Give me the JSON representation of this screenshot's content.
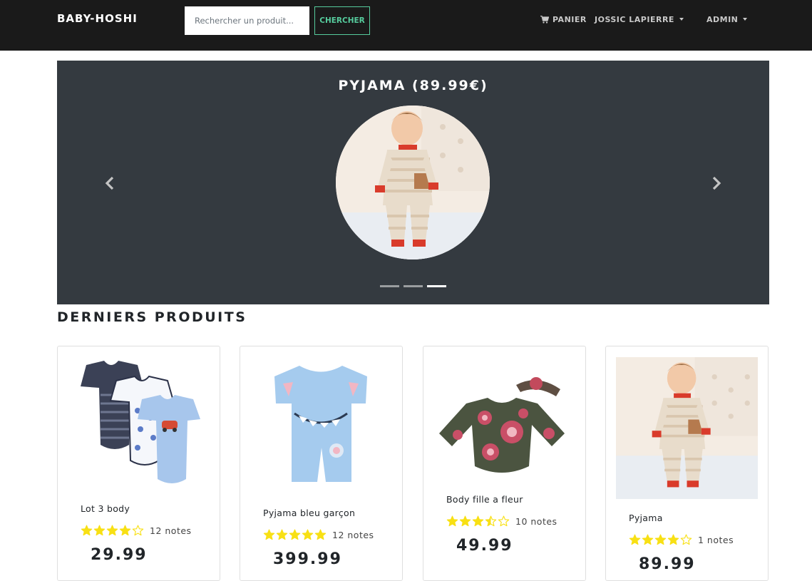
{
  "navbar": {
    "brand": "BABY-HOSHI",
    "search": {
      "placeholder": "Rechercher un produit...",
      "value": ""
    },
    "search_button": "CHERCHER",
    "cart_label": "PANIER",
    "user_label": "JOSSIC LAPIERRE",
    "admin_label": "ADMIN"
  },
  "carousel": {
    "title": "PYJAMA (89.99€)",
    "slide_count": 3,
    "active_index": 2
  },
  "section": {
    "title": "DERNIERS PRODUITS"
  },
  "products": [
    {
      "name": "Lot 3 body",
      "rating": 4,
      "rating_text": "12 notes",
      "price": "29.99"
    },
    {
      "name": "Pyjama bleu garçon",
      "rating": 5,
      "rating_text": "12 notes",
      "price": "399.99"
    },
    {
      "name": "Body fille a fleur",
      "rating": 3.5,
      "rating_text": "10 notes",
      "price": "49.99"
    },
    {
      "name": "Pyjama",
      "rating": 4,
      "rating_text": "1 notes",
      "price": "89.99"
    }
  ],
  "colors": {
    "navbar_bg": "#1a1a1a",
    "accent": "#56cc9d",
    "carousel_bg": "#343a40",
    "star": "#f8e014"
  }
}
